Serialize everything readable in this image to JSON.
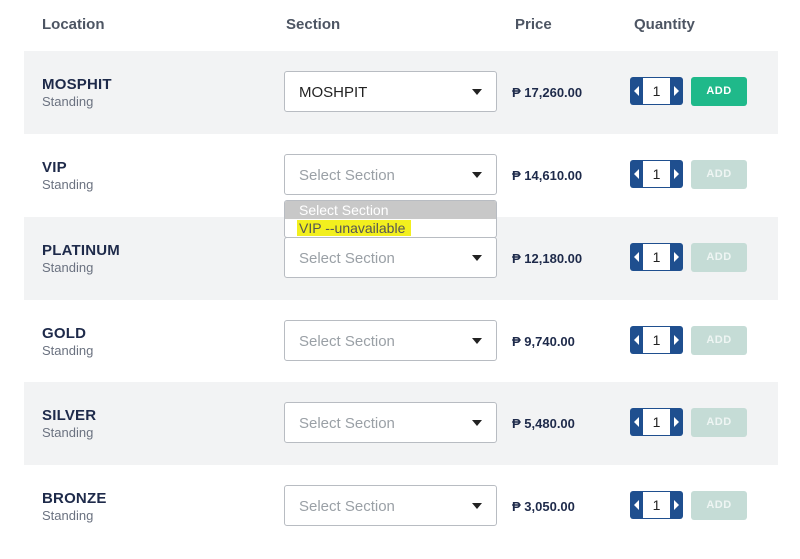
{
  "header": {
    "location": "Location",
    "section": "Section",
    "price": "Price",
    "quantity": "Quantity"
  },
  "rows": [
    {
      "name": "MOSPHIT",
      "sub": "Standing",
      "section": "MOSHPIT",
      "price": "₱ 17,260.00",
      "qty": "1",
      "add": "ADD",
      "add_enabled": true
    },
    {
      "name": "VIP",
      "sub": "Standing",
      "section": "Select Section",
      "price": "₱ 14,610.00",
      "qty": "1",
      "add": "ADD",
      "add_enabled": false
    },
    {
      "name": "PLATINUM",
      "sub": "Standing",
      "section": "Select Section",
      "price": "₱ 12,180.00",
      "qty": "1",
      "add": "ADD",
      "add_enabled": false
    },
    {
      "name": "GOLD",
      "sub": "Standing",
      "section": "Select Section",
      "price": "₱ 9,740.00",
      "qty": "1",
      "add": "ADD",
      "add_enabled": false
    },
    {
      "name": "SILVER",
      "sub": "Standing",
      "section": "Select Section",
      "price": "₱ 5,480.00",
      "qty": "1",
      "add": "ADD",
      "add_enabled": false
    },
    {
      "name": "BRONZE",
      "sub": "Standing",
      "section": "Select Section",
      "price": "₱ 3,050.00",
      "qty": "1",
      "add": "ADD",
      "add_enabled": false
    }
  ],
  "dropdown": {
    "options": [
      "Select Section",
      "VIP --unavailable"
    ]
  },
  "colors": {
    "add_active": "#1fb98a",
    "add_disabled": "#c5dcd6",
    "stepper": "#1f4f8f",
    "row_shade": "#f2f3f4",
    "highlight": "#f2ef1e"
  },
  "icons": {
    "select_caret": "caret-down-icon",
    "decrement": "left-arrow-icon",
    "increment": "right-arrow-icon"
  }
}
